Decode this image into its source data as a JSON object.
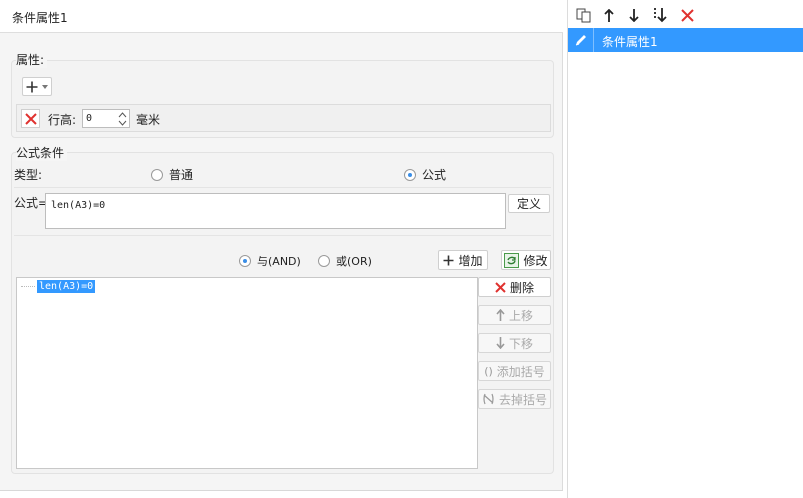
{
  "header": {
    "title": "条件属性1"
  },
  "attributes": {
    "title": "属性:",
    "row_height_label": "行高:",
    "row_height_value": "0",
    "unit_label": "毫米"
  },
  "formula_condition": {
    "title": "公式条件",
    "type_label": "类型:",
    "type_options": [
      "普通",
      "公式"
    ],
    "selected_type": "公式",
    "formula_label": "公式=",
    "formula_value": "len(A3)=0",
    "define_label": "定义",
    "logic_options": [
      "与(AND)",
      "或(OR)"
    ],
    "selected_logic": "与(AND)",
    "add_label": "增加",
    "modify_label": "修改",
    "conditions": [
      "len(A3)=0"
    ],
    "side_buttons": {
      "delete": "删除",
      "move_up": "上移",
      "move_down": "下移",
      "add_bracket": "添加括号",
      "remove_bracket": "去掉括号"
    }
  },
  "right_panel": {
    "items": [
      {
        "label": "条件属性1",
        "selected": true
      }
    ]
  },
  "colors": {
    "selection_blue": "#3399ff",
    "delete_red": "#e0322f",
    "icon_dark": "#333333"
  }
}
